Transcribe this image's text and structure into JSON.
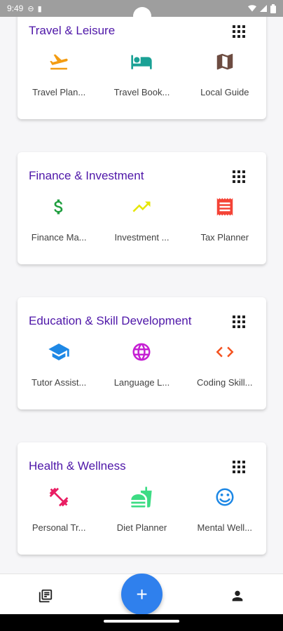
{
  "status_bar": {
    "time": "9:49"
  },
  "categories": [
    {
      "title": "Travel & Leisure",
      "apps": [
        {
          "label": "Travel Plan...",
          "icon": "flight-takeoff-icon",
          "color": "#f39c12"
        },
        {
          "label": "Travel Book...",
          "icon": "hotel-bed-icon",
          "color": "#1aa195"
        },
        {
          "label": "Local Guide",
          "icon": "map-icon",
          "color": "#6d4c41"
        }
      ]
    },
    {
      "title": "Finance & Investment",
      "apps": [
        {
          "label": "Finance Ma...",
          "icon": "dollar-icon",
          "color": "#1e9e3e"
        },
        {
          "label": "Investment ...",
          "icon": "trending-up-icon",
          "color": "#e6e600"
        },
        {
          "label": "Tax Planner",
          "icon": "receipt-icon",
          "color": "#f44336"
        }
      ]
    },
    {
      "title": "Education & Skill Development",
      "apps": [
        {
          "label": "Tutor Assist...",
          "icon": "school-icon",
          "color": "#1e88e5"
        },
        {
          "label": "Language L...",
          "icon": "globe-icon",
          "color": "#c51fd3"
        },
        {
          "label": "Coding Skill...",
          "icon": "code-icon",
          "color": "#f4511e"
        }
      ]
    },
    {
      "title": "Health & Wellness",
      "apps": [
        {
          "label": "Personal Tr...",
          "icon": "fitness-dumbbell-icon",
          "color": "#e91e63"
        },
        {
          "label": "Diet Planner",
          "icon": "food-icon",
          "color": "#3ddc84"
        },
        {
          "label": "Mental Well...",
          "icon": "smiley-icon",
          "color": "#1e88e5"
        }
      ]
    }
  ],
  "bottom_nav": {
    "left_icon": "library-icon",
    "fab_label": "+",
    "right_icon": "person-icon"
  }
}
